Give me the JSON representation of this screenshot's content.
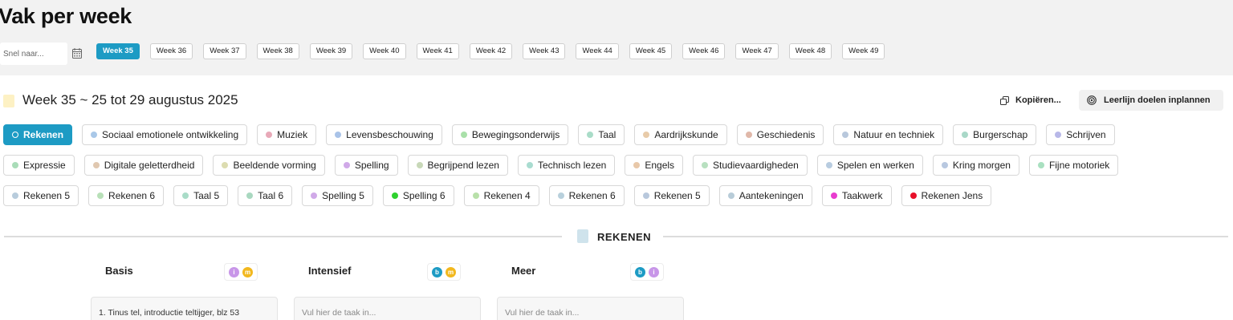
{
  "page_title": "Vak per week",
  "search": {
    "placeholder": "Snel naar..."
  },
  "weeks": [
    {
      "label": "Week 35",
      "active": true
    },
    {
      "label": "Week 36"
    },
    {
      "label": "Week 37"
    },
    {
      "label": "Week 38"
    },
    {
      "label": "Week 39"
    },
    {
      "label": "Week 40"
    },
    {
      "label": "Week 41"
    },
    {
      "label": "Week 42"
    },
    {
      "label": "Week 43"
    },
    {
      "label": "Week 44"
    },
    {
      "label": "Week 45"
    },
    {
      "label": "Week 46"
    },
    {
      "label": "Week 47"
    },
    {
      "label": "Week 48"
    },
    {
      "label": "Week 49"
    }
  ],
  "week_heading": "Week 35 ~ 25 tot 29 augustus 2025",
  "actions": {
    "copy_label": "Kopiëren...",
    "plan_label": "Leerlijn doelen inplannen"
  },
  "subjects": [
    {
      "label": "Rekenen",
      "color": "#1d9bc4",
      "active": true
    },
    {
      "label": "Sociaal emotionele ontwikkeling",
      "color": "#a9c8e8"
    },
    {
      "label": "Muziek",
      "color": "#e8a9b8"
    },
    {
      "label": "Levensbeschouwing",
      "color": "#a9c3e8"
    },
    {
      "label": "Bewegingsonderwijs",
      "color": "#a9e0a9"
    },
    {
      "label": "Taal",
      "color": "#a9dcc8"
    },
    {
      "label": "Aardrijkskunde",
      "color": "#e8cba9"
    },
    {
      "label": "Geschiedenis",
      "color": "#e0b8a9"
    },
    {
      "label": "Natuur en techniek",
      "color": "#b8c8dc"
    },
    {
      "label": "Burgerschap",
      "color": "#a9d8c8"
    },
    {
      "label": "Schrijven",
      "color": "#b8b8e8"
    },
    {
      "label": "Expressie",
      "color": "#a9dcb8"
    },
    {
      "label": "Digitale geletterdheid",
      "color": "#e0c8b0"
    },
    {
      "label": "Beeldende vorming",
      "color": "#dcdcb0"
    },
    {
      "label": "Spelling",
      "color": "#d0a9e8"
    },
    {
      "label": "Begrijpend lezen",
      "color": "#c8d8b8"
    },
    {
      "label": "Technisch lezen",
      "color": "#a9dcd0"
    },
    {
      "label": "Engels",
      "color": "#e8c8a9"
    },
    {
      "label": "Studievaardigheden",
      "color": "#b8e0c0"
    },
    {
      "label": "Spelen en werken",
      "color": "#b8cce0"
    },
    {
      "label": "Kring morgen",
      "color": "#b8c8e0"
    },
    {
      "label": "Fijne motoriek",
      "color": "#a9e0c0"
    },
    {
      "label": "Rekenen 5",
      "color": "#b8ccdc"
    },
    {
      "label": "Rekenen 6",
      "color": "#b8e0b8"
    },
    {
      "label": "Taal 5",
      "color": "#a9dcc8"
    },
    {
      "label": "Taal 6",
      "color": "#a9d8c0"
    },
    {
      "label": "Spelling 5",
      "color": "#d0a9e8"
    },
    {
      "label": "Spelling 6",
      "color": "#2ed12e"
    },
    {
      "label": "Rekenen 4",
      "color": "#b8e0a9"
    },
    {
      "label": "Rekenen 6",
      "color": "#b8d0dc"
    },
    {
      "label": "Rekenen 5",
      "color": "#b8c8dc"
    },
    {
      "label": "Aantekeningen",
      "color": "#b8ccd8"
    },
    {
      "label": "Taakwerk",
      "color": "#e83ccf"
    },
    {
      "label": "Rekenen Jens",
      "color": "#e8102a"
    }
  ],
  "section": {
    "title": "REKENEN"
  },
  "columns": [
    {
      "title": "Basis",
      "badges": [
        {
          "letter": "i",
          "color": "#c896e8"
        },
        {
          "letter": "m",
          "color": "#f2b81e"
        }
      ],
      "task_value": "1. Tinus tel, introductie teltijger, blz 53",
      "task_placeholder": ""
    },
    {
      "title": "Intensief",
      "badges": [
        {
          "letter": "b",
          "color": "#1d9bc4"
        },
        {
          "letter": "m",
          "color": "#f2b81e"
        }
      ],
      "task_value": "",
      "task_placeholder": "Vul hier de taak in..."
    },
    {
      "title": "Meer",
      "badges": [
        {
          "letter": "b",
          "color": "#1d9bc4"
        },
        {
          "letter": "i",
          "color": "#c896e8"
        }
      ],
      "task_value": "",
      "task_placeholder": "Vul hier de taak in..."
    }
  ]
}
